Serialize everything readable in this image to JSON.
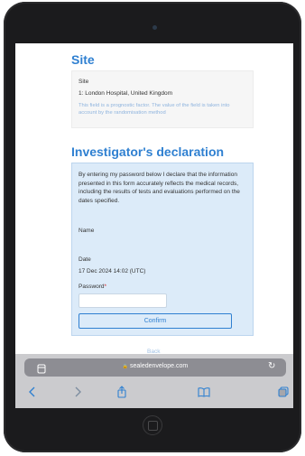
{
  "site": {
    "heading": "Site",
    "label": "Site",
    "value": "1: London Hospital, United Kingdom",
    "help": "This field is a prognostic factor. The value of the field is taken into account by the randomisation method"
  },
  "investigator": {
    "heading": "Investigator's declaration",
    "declaration": "By entering my password below I declare that the information presented in this form accurately reflects the medical records, including the results of tests and evaluations performed on the dates specified.",
    "name_label": "Name",
    "date_label": "Date",
    "date_value": "17 Dec 2024 14:02 (UTC)",
    "password_label": "Password",
    "required_marker": "*",
    "password_value": "",
    "confirm_label": "Confirm"
  },
  "back_link": "Back",
  "browser": {
    "url": "sealedenvelope.com",
    "lock": "🔒"
  },
  "icons": {
    "tabs": "tabs-icon",
    "reload": "reload-icon",
    "back": "back-arrow-icon",
    "forward": "forward-arrow-icon",
    "share": "share-icon",
    "bookmarks": "bookmarks-icon",
    "tab_overview": "tab-overview-icon"
  },
  "colors": {
    "accent": "#2f80d1",
    "panel": "#dcebf9",
    "help_text": "#8fb4de",
    "required": "#d12b2b"
  }
}
